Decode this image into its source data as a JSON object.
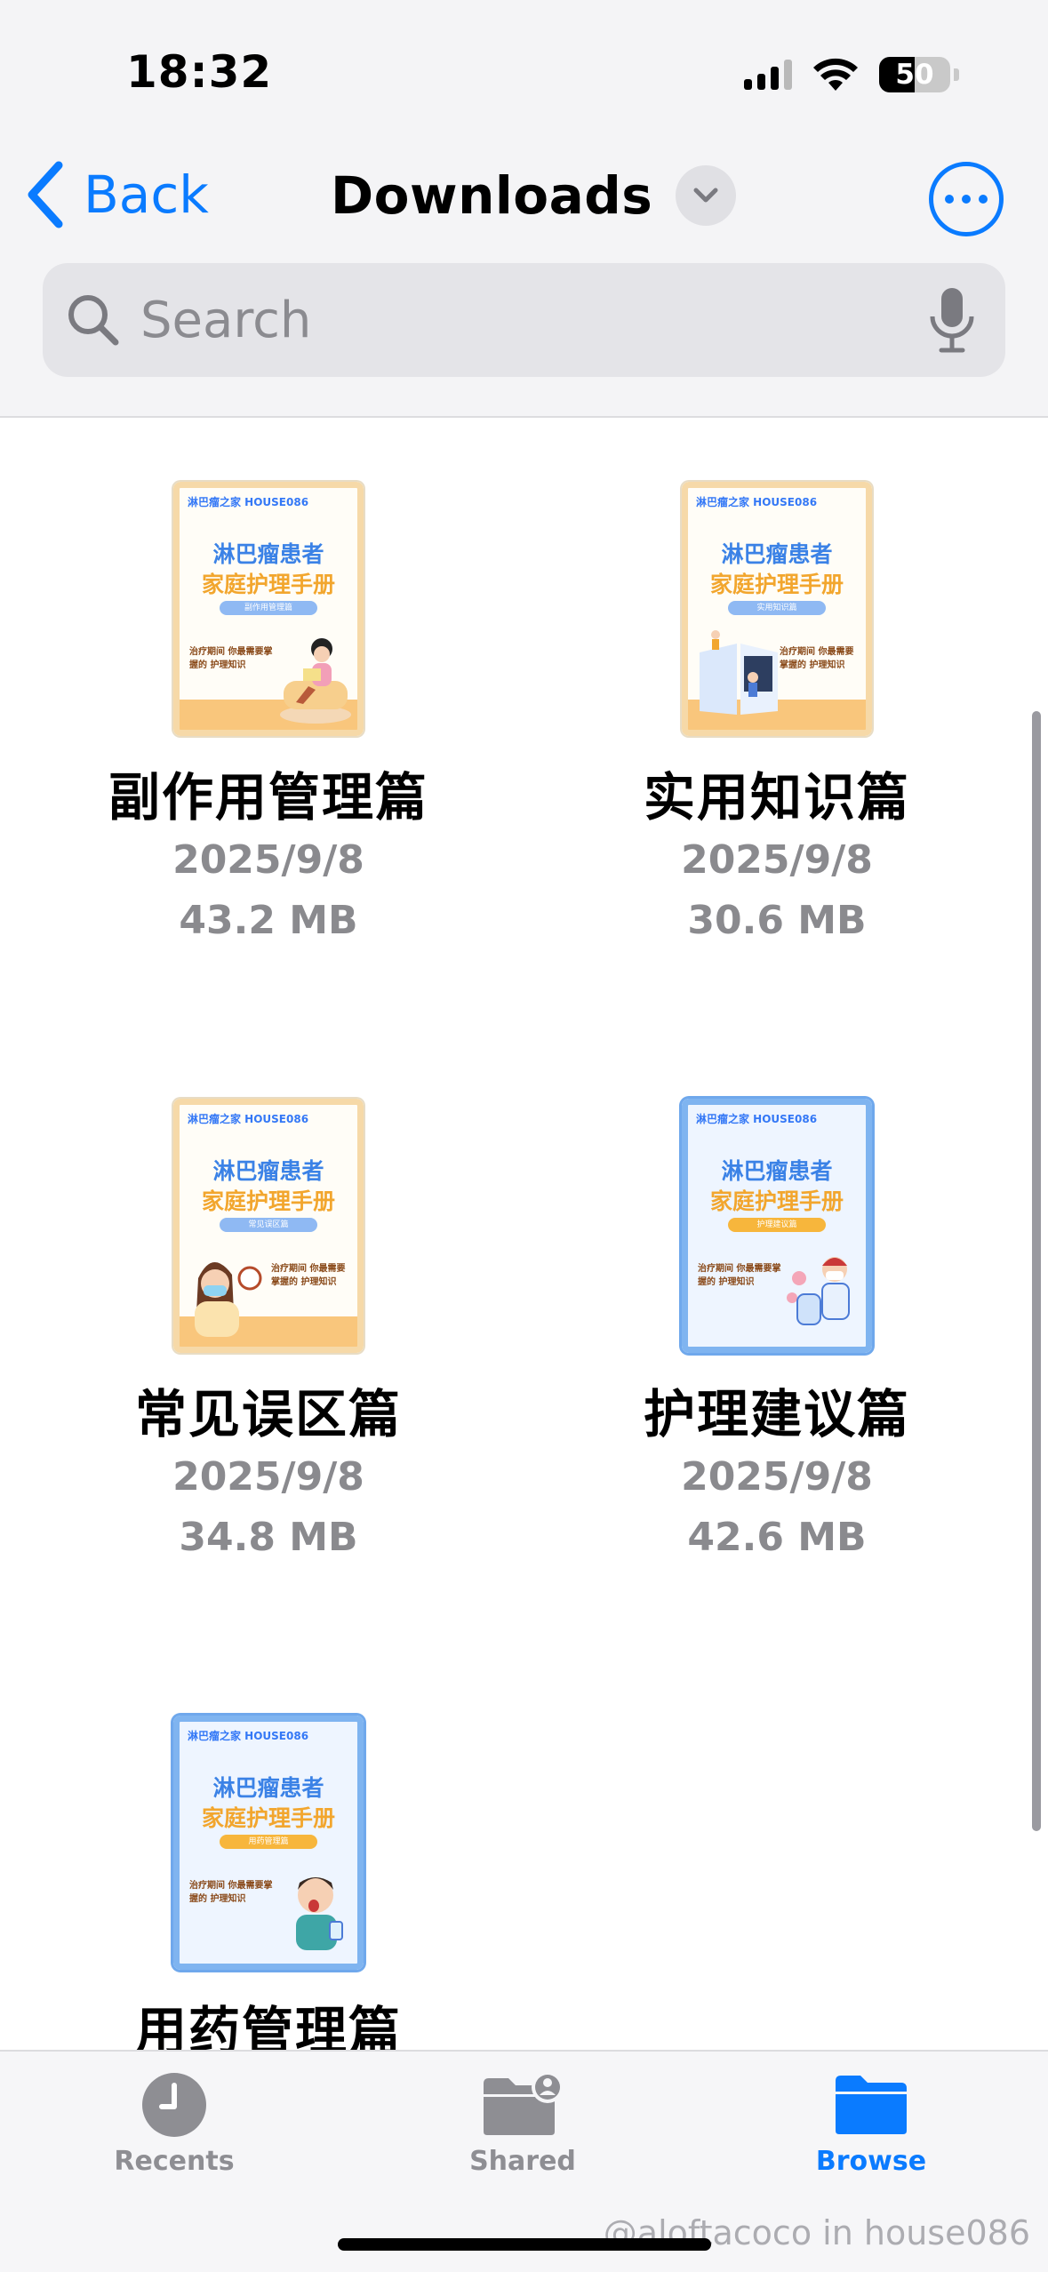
{
  "status_bar": {
    "time": "18:32",
    "battery": "50"
  },
  "nav": {
    "back_label": "Back",
    "title": "Downloads"
  },
  "search": {
    "placeholder": "Search"
  },
  "files": [
    {
      "name": "副作用管理篇",
      "date": "2025/9/8",
      "size": "43.2 MB",
      "cover": {
        "logo": "淋巴瘤之家 HOUSE086",
        "title_line1": "淋巴瘤患者",
        "title_line2": "家庭护理手册",
        "tag": "副作用管理篇",
        "subtitle": "治疗期间 你最需要掌握的 护理知识"
      }
    },
    {
      "name": "实用知识篇",
      "date": "2025/9/8",
      "size": "30.6 MB",
      "cover": {
        "logo": "淋巴瘤之家 HOUSE086",
        "title_line1": "淋巴瘤患者",
        "title_line2": "家庭护理手册",
        "tag": "实用知识篇",
        "subtitle": "治疗期间 你最需要掌握的 护理知识"
      }
    },
    {
      "name": "常见误区篇",
      "date": "2025/9/8",
      "size": "34.8 MB",
      "cover": {
        "logo": "淋巴瘤之家 HOUSE086",
        "title_line1": "淋巴瘤患者",
        "title_line2": "家庭护理手册",
        "tag": "常见误区篇",
        "subtitle": "治疗期间 你最需要掌握的 护理知识"
      }
    },
    {
      "name": "护理建议篇",
      "date": "2025/9/8",
      "size": "42.6 MB",
      "cover": {
        "logo": "淋巴瘤之家 HOUSE086",
        "title_line1": "淋巴瘤患者",
        "title_line2": "家庭护理手册",
        "tag": "护理建议篇",
        "subtitle": "治疗期间 你最需要掌握的 护理知识"
      }
    },
    {
      "name": "用药管理篇",
      "cover": {
        "logo": "淋巴瘤之家 HOUSE086",
        "title_line1": "淋巴瘤患者",
        "title_line2": "家庭护理手册",
        "tag": "用药管理篇",
        "subtitle": "治疗期间 你最需要掌握的 护理知识"
      }
    }
  ],
  "tabs": [
    {
      "label": "Recents",
      "icon": "clock-icon"
    },
    {
      "label": "Shared",
      "icon": "shared-folder-icon"
    },
    {
      "label": "Browse",
      "icon": "folder-icon",
      "active": true
    }
  ],
  "watermark": "@aloftacoco in house086",
  "colors": {
    "accent": "#0a7bff",
    "secondary_text": "#8a8a8e"
  }
}
